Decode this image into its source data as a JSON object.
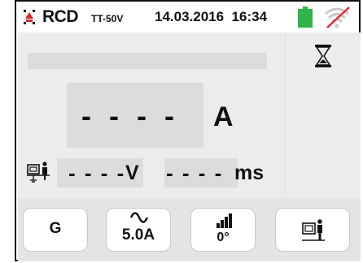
{
  "status_bar": {
    "mode": "RCD",
    "mode_sub": "TT-50V",
    "date": "14.03.2016",
    "time": "16:34",
    "battery_icon": "battery-full-icon",
    "wireless_icon": "wireless-disabled-icon"
  },
  "display": {
    "hourglass_icon": "hourglass-icon",
    "main_value": "- - - -",
    "main_unit": "A",
    "voltage_value": "- - - -",
    "voltage_unit": "V",
    "time_value": "- - - -",
    "time_unit": "ms",
    "touch_icon": "touch-contact-icon"
  },
  "keys": {
    "type": "G",
    "current": "5.0A",
    "current_icon": "ac-sine-icon",
    "phase": "0°",
    "phase_icon": "ramp-icon",
    "touch_icon": "touch-contact-icon"
  },
  "colors": {
    "battery": "#2fb34a",
    "wireless_disabled_slash": "#e8283c",
    "panel": "#ececec",
    "box": "#dcdcdc"
  }
}
